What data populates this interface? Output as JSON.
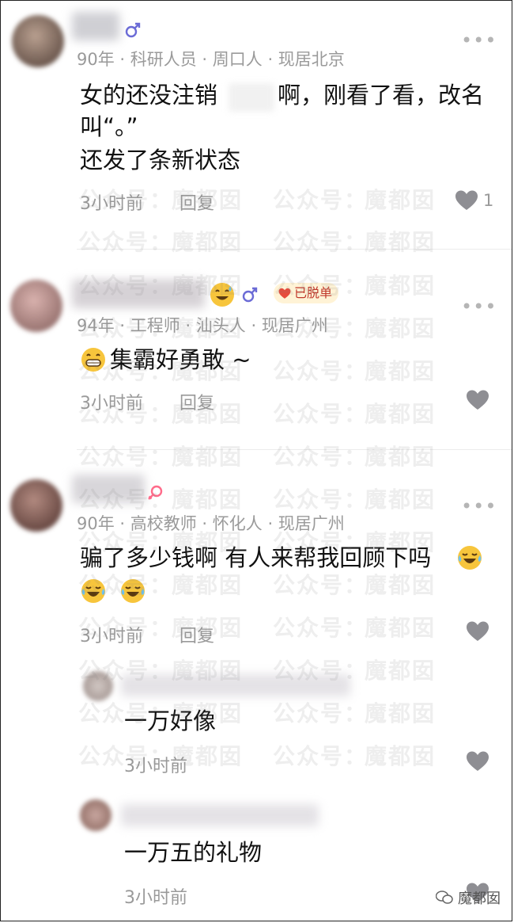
{
  "comments": [
    {
      "meta": "90年 · 科研人员 · 周口人 · 现居北京",
      "text_line1a": "女的还没注销",
      "text_line1b": "啊，刚看了看，改名",
      "text_line2": "叫“。”",
      "text_line3": "还发了条新状态",
      "time": "3小时前",
      "reply": "回复",
      "likes": "1"
    },
    {
      "meta": "94年 · 工程师 · 汕头人 · 现居广州",
      "badge": "已脱单",
      "text": "集霸好勇敢 ~",
      "time": "3小时前",
      "reply": "回复"
    },
    {
      "meta": "90年 · 高校教师 · 怀化人 · 现居广州",
      "text_line1": "骗了多少钱啊 有人来帮我回顾下吗",
      "time": "3小时前",
      "reply": "回复"
    }
  ],
  "replies": [
    {
      "text": "一万好像",
      "time": "3小时前"
    },
    {
      "text": "一万五的礼物",
      "time": "3小时前"
    }
  ],
  "more_label": "•••",
  "watermark": {
    "prefix": "公众号：",
    "name": "魔都囡"
  },
  "brand": "魔都囡",
  "colors": {
    "heart": "#8e8e93",
    "male": "#6b6bd6",
    "female": "#ff6b8a",
    "badge_bg": "#fff3d6"
  }
}
